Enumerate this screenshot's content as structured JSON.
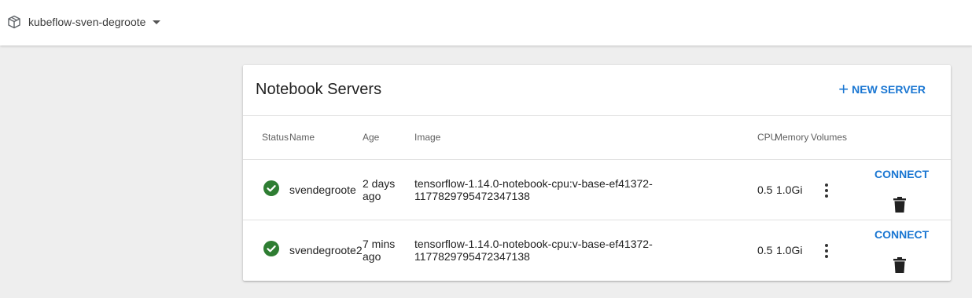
{
  "topbar": {
    "namespace": "kubeflow-sven-degroote",
    "namespace_icon": "cube-icon",
    "caret_icon": "caret-down-icon"
  },
  "card": {
    "title": "Notebook Servers",
    "new_server_label": "NEW SERVER",
    "new_server_icon": "plus-icon"
  },
  "table": {
    "headers": {
      "status": "Status",
      "name": "Name",
      "age": "Age",
      "image": "Image",
      "cpu": "CPU",
      "memory": "Memory",
      "volumes": "Volumes"
    },
    "rows": [
      {
        "status": "running",
        "status_icon": "check-circle-icon",
        "name": "svendegroote",
        "age_line1": "2 days",
        "age_line2": "ago",
        "image_line1": "tensorflow-1.14.0-notebook-cpu:v-base-ef41372-",
        "image_line2": "1177829795472347138",
        "cpu": "0.5",
        "memory": "1.0Gi",
        "connect_label": "CONNECT"
      },
      {
        "status": "running",
        "status_icon": "check-circle-icon",
        "name": "svendegroote2",
        "age_line1": "7 mins",
        "age_line2": "ago",
        "image_line1": "tensorflow-1.14.0-notebook-cpu:v-base-ef41372-",
        "image_line2": "1177829795472347138",
        "cpu": "0.5",
        "memory": "1.0Gi",
        "connect_label": "CONNECT"
      }
    ]
  },
  "colors": {
    "accent": "#1976d2",
    "success": "#2e7d32",
    "background": "#eeeeee"
  }
}
